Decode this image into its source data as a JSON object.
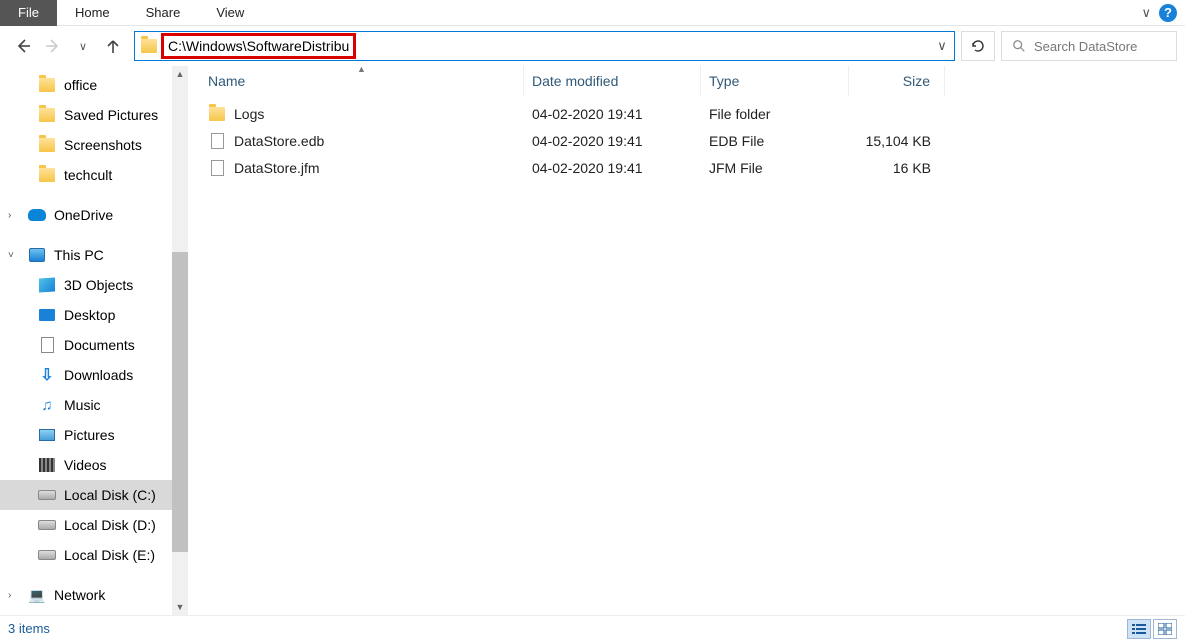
{
  "ribbon": {
    "file": "File",
    "tabs": [
      "Home",
      "Share",
      "View"
    ]
  },
  "address": {
    "path": "C:\\Windows\\SoftwareDistribution\\DataStore"
  },
  "search": {
    "placeholder": "Search DataStore"
  },
  "tree": {
    "items": [
      {
        "label": "office",
        "type": "folder",
        "lvl": 2
      },
      {
        "label": "Saved Pictures",
        "type": "folder",
        "lvl": 2
      },
      {
        "label": "Screenshots",
        "type": "folder",
        "lvl": 2
      },
      {
        "label": "techcult",
        "type": "folder",
        "lvl": 2
      },
      {
        "label": "",
        "spacer": true
      },
      {
        "label": "OneDrive",
        "type": "onedrive",
        "lvl": 1,
        "caret": ">"
      },
      {
        "label": "",
        "spacer": true
      },
      {
        "label": "This PC",
        "type": "thispc",
        "lvl": 1,
        "caret": "v"
      },
      {
        "label": "3D Objects",
        "type": "3d",
        "lvl": 2
      },
      {
        "label": "Desktop",
        "type": "desktop",
        "lvl": 2
      },
      {
        "label": "Documents",
        "type": "doc",
        "lvl": 2
      },
      {
        "label": "Downloads",
        "type": "down",
        "lvl": 2
      },
      {
        "label": "Music",
        "type": "music",
        "lvl": 2
      },
      {
        "label": "Pictures",
        "type": "pic",
        "lvl": 2
      },
      {
        "label": "Videos",
        "type": "vid",
        "lvl": 2
      },
      {
        "label": "Local Disk (C:)",
        "type": "drive",
        "lvl": 2,
        "selected": true
      },
      {
        "label": "Local Disk (D:)",
        "type": "drive",
        "lvl": 2
      },
      {
        "label": "Local Disk (E:)",
        "type": "drive",
        "lvl": 2
      },
      {
        "label": "",
        "spacer": true
      },
      {
        "label": "Network",
        "type": "net",
        "lvl": 1,
        "caret": ">"
      }
    ]
  },
  "columns": {
    "name": "Name",
    "date": "Date modified",
    "type": "Type",
    "size": "Size"
  },
  "rows": [
    {
      "icon": "folder",
      "name": "Logs",
      "date": "04-02-2020 19:41",
      "type": "File folder",
      "size": ""
    },
    {
      "icon": "file",
      "name": "DataStore.edb",
      "date": "04-02-2020 19:41",
      "type": "EDB File",
      "size": "15,104 KB"
    },
    {
      "icon": "file",
      "name": "DataStore.jfm",
      "date": "04-02-2020 19:41",
      "type": "JFM File",
      "size": "16 KB"
    }
  ],
  "status": {
    "text": "3 items"
  }
}
